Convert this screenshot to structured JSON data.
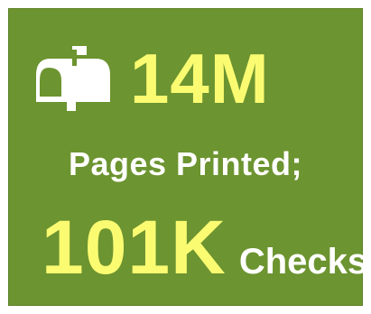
{
  "stat1": {
    "icon": "mailbox-icon",
    "value": "14M"
  },
  "line2": "Pages Printed;",
  "stat2": {
    "value": "101K",
    "label": "Checks"
  },
  "colors": {
    "background": "#6c9430",
    "highlight": "#fbfb72",
    "text": "#ffffff"
  }
}
